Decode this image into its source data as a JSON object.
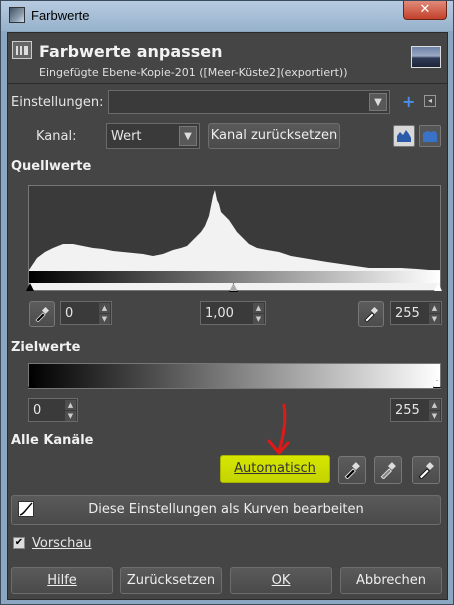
{
  "window": {
    "title": "Farbwerte",
    "close_glyph": "✕"
  },
  "header": {
    "title": "Farbwerte anpassen",
    "subtitle": "Eingefügte Ebene-Kopie-201 ([Meer-Küste2](exportiert))"
  },
  "settings": {
    "label": "Einstellungen:",
    "value": "",
    "add_icon": "+",
    "menu_icon": "◂"
  },
  "channel": {
    "label": "Kanal:",
    "value": "Wert",
    "reset_button": "Kanal zurücksetzen"
  },
  "source": {
    "title": "Quellwerte",
    "low": "0",
    "gamma": "1,00",
    "high": "255"
  },
  "target": {
    "title": "Zielwerte",
    "low": "0",
    "high": "255"
  },
  "all_channels": {
    "title": "Alle Kanäle",
    "auto_button": "Automatisch"
  },
  "curves_button": "Diese Einstellungen als Kurven bearbeiten",
  "preview": {
    "label": "Vorschau",
    "checked": true
  },
  "footer": {
    "help": "Hilfe",
    "reset": "Zurücksetzen",
    "ok": "OK",
    "cancel": "Abbrechen"
  },
  "colors": {
    "dialog_bg": "#454545",
    "highlight": "#d8e600",
    "annotation_arrow": "#e01818"
  }
}
